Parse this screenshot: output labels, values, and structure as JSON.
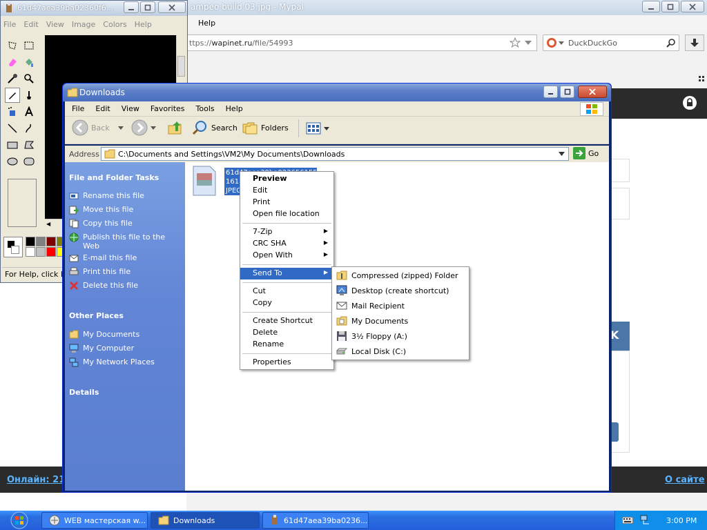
{
  "browser": {
    "title": "ampeo build 03.jpg - Mypal",
    "menu_help": "Help",
    "url_prefix": "ttps://",
    "url_host": "wapinet.ru",
    "url_path": "/file/54993",
    "search_engine": "DuckDuckGo",
    "online_label": "Онлайн: 21",
    "about_label": "О сайте",
    "card_text": "K"
  },
  "paint": {
    "title": "61d47aea39ba02360f6...",
    "menu": [
      "File",
      "Edit",
      "View",
      "Image",
      "Colors",
      "Help"
    ],
    "status": "For Help, click H",
    "palette": [
      "#000000",
      "#808080",
      "#800000",
      "#808000",
      "#ffffff",
      "#c0c0c0",
      "#ff0000",
      "#ffff00"
    ]
  },
  "explorer": {
    "title": "Downloads",
    "menu": [
      "File",
      "Edit",
      "View",
      "Favorites",
      "Tools",
      "Help"
    ],
    "toolbar": {
      "back": "Back",
      "search": "Search",
      "folders": "Folders"
    },
    "address_label": "Address",
    "address_value": "C:\\Documents and Settings\\VM2\\My Documents\\Downloads",
    "go_label": "Go",
    "file_tasks_title": "File and Folder Tasks",
    "file_tasks": [
      "Rename this file",
      "Move this file",
      "Copy this file",
      "Publish this file to the Web",
      "E-mail this file",
      "Print this file",
      "Delete this file"
    ],
    "other_places_title": "Other Places",
    "other_places": [
      "My Documents",
      "My Computer",
      "My Network Places"
    ],
    "details_title": "Details",
    "file_name_lines": [
      "61d47aea39ba023656155",
      "1618",
      "JPEG"
    ]
  },
  "context_menu": {
    "items": [
      "Preview",
      "Edit",
      "Print",
      "Open file location",
      "7-Zip",
      "CRC SHA",
      "Open With",
      "Send To",
      "Cut",
      "Copy",
      "Create Shortcut",
      "Delete",
      "Rename",
      "Properties"
    ]
  },
  "send_to": {
    "items": [
      "Compressed (zipped) Folder",
      "Desktop (create shortcut)",
      "Mail Recipient",
      "My Documents",
      "3½ Floppy (A:)",
      "Local Disk (C:)"
    ]
  },
  "taskbar": {
    "items": [
      "WEB мастерская w...",
      "Downloads",
      "61d47aea39ba0236..."
    ],
    "clock": "3:00 PM"
  }
}
